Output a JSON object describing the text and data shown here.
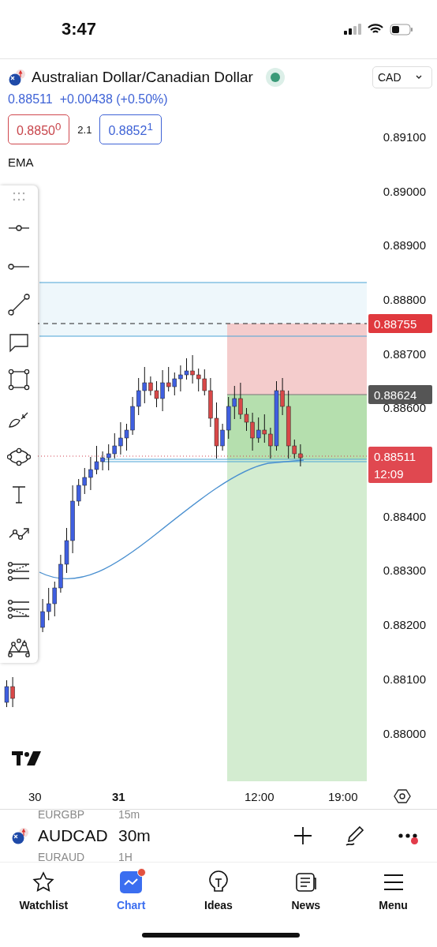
{
  "status_bar": {
    "time": "3:47"
  },
  "header": {
    "title": "Australian Dollar/Canadian Dollar",
    "live": true,
    "currency": "CAD",
    "last": "0.88511",
    "change": "+0.00438 (+0.50%)",
    "bid": "0.8850$^{0}$",
    "spread": "2.1",
    "ask": "0.8852$^{1}$",
    "indicator": "EMA"
  },
  "price_axis": [
    "0.89100",
    "0.89000",
    "0.88900",
    "0.88800",
    "0.88700",
    "0.88600",
    "0.88400",
    "0.88300",
    "0.88200",
    "0.88100",
    "0.88000"
  ],
  "price_tags": [
    {
      "kind": "stop",
      "text": "0.88755"
    },
    {
      "kind": "entry",
      "text": "0.88624"
    },
    {
      "kind": "last",
      "text": "0.88511",
      "sub": "12:09"
    }
  ],
  "time_axis": [
    {
      "text": "30",
      "bold": false
    },
    {
      "text": "31",
      "bold": true
    },
    {
      "text": "12:00",
      "bold": false
    },
    {
      "text": "19:00",
      "bold": false
    }
  ],
  "symbols": [
    {
      "symbol": "EURGBP",
      "interval": "15m",
      "selected": false
    },
    {
      "symbol": "AUDCAD",
      "interval": "30m",
      "selected": true
    },
    {
      "symbol": "EURAUD",
      "interval": "1H",
      "selected": false
    }
  ],
  "more_badge": true,
  "tabs": [
    {
      "label": "Watchlist",
      "selected": false,
      "badge": false
    },
    {
      "label": "Chart",
      "selected": true,
      "badge": true
    },
    {
      "label": "Ideas",
      "selected": false,
      "badge": false
    },
    {
      "label": "News",
      "selected": false,
      "badge": false
    },
    {
      "label": "Menu",
      "selected": false,
      "badge": false
    }
  ]
}
